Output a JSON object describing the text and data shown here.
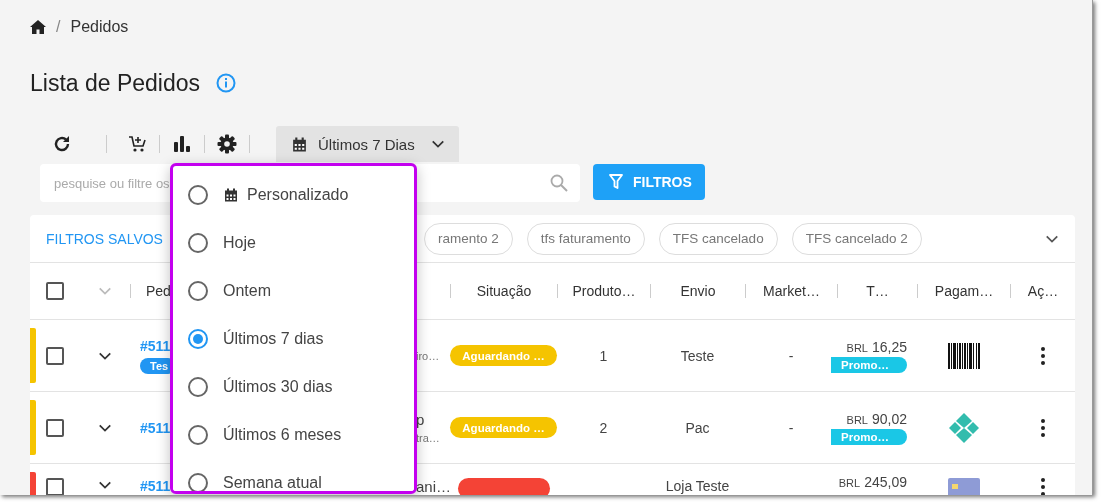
{
  "breadcrumb": {
    "separator": "/",
    "current": "Pedidos"
  },
  "page_title": "Lista de Pedidos",
  "toolbar": {
    "date_button": {
      "label": "Últimos 7 Dias"
    }
  },
  "search": {
    "placeholder": "pesquise ou filtre os"
  },
  "filter_button": {
    "label": "FILTROS"
  },
  "saved_filters": {
    "label": "FILTROS SALVOS",
    "chips": [
      "ramento 2",
      "tfs faturamento",
      "TFS cancelado",
      "TFS cancelado 2"
    ]
  },
  "table": {
    "columns": [
      "Ped",
      "Situação",
      "Produto…",
      "Envio",
      "Market…",
      "T…",
      "Pagam…",
      "Aç…"
    ],
    "select_all": {
      "checked": false
    },
    "rows": [
      {
        "color": "#f5c400",
        "checked": false,
        "expanded": false,
        "order": "#511",
        "tag": "Tes",
        "customer_detail": "iro…",
        "status": {
          "label": "Aguardando …",
          "color": "#f5c400"
        },
        "products": "1",
        "shipping": "Teste",
        "marketplace": "-",
        "currency": "BRL",
        "total": "16,25",
        "promo": "Promo…",
        "payment": {
          "kind": "boleto"
        }
      },
      {
        "color": "#f5c400",
        "checked": false,
        "expanded": false,
        "order": "#511",
        "customer_name": "p",
        "customer_detail": "tra…",
        "status": {
          "label": "Aguardando …",
          "color": "#f5c400"
        },
        "products": "2",
        "shipping": "Pac",
        "marketplace": "-",
        "currency": "BRL",
        "total": "90,02",
        "promo": "Promo…",
        "payment": {
          "kind": "pix"
        }
      },
      {
        "color": "#f44336",
        "checked": false,
        "expanded": false,
        "order": "#511",
        "customer_name": "ani…",
        "status": {
          "color": "#f44336"
        },
        "shipping": "Loja Teste",
        "currency": "BRL",
        "total": "245,09",
        "payment": {
          "kind": "card"
        }
      }
    ]
  },
  "date_menu": {
    "options": [
      {
        "label": "Personalizado",
        "kind": "custom",
        "selected": false
      },
      {
        "label": "Hoje",
        "kind": "preset",
        "selected": false
      },
      {
        "label": "Ontem",
        "kind": "preset",
        "selected": false
      },
      {
        "label": "Últimos 7 dias",
        "kind": "preset",
        "selected": true
      },
      {
        "label": "Últimos 30 dias",
        "kind": "preset",
        "selected": false
      },
      {
        "label": "Últimos 6 meses",
        "kind": "preset",
        "selected": false
      },
      {
        "label": "Semana atual",
        "kind": "preset",
        "selected": false
      }
    ]
  }
}
